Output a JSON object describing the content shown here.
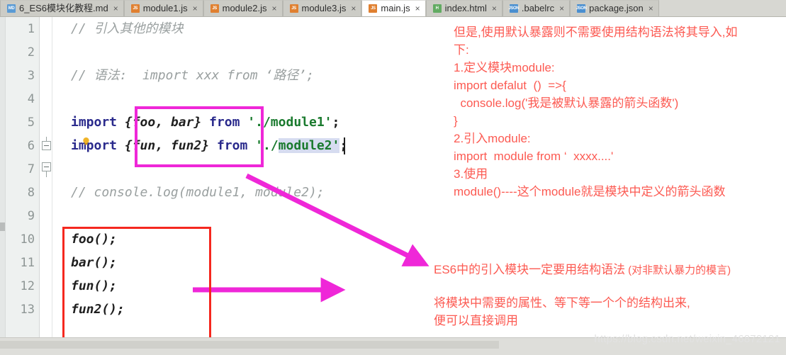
{
  "window": {
    "app": "WebStorm code editor",
    "watermark": "https://blog.csdn.net/weixin_46872121"
  },
  "tabs": [
    {
      "label": "6_ES6模块化教程.md",
      "icon": "markdown-file-icon",
      "icon_text": "MD",
      "icon_class": "icon-md",
      "active": false,
      "close": "×"
    },
    {
      "label": "module1.js",
      "icon": "javascript-file-icon",
      "icon_text": "JS",
      "icon_class": "icon-js",
      "active": false,
      "close": "×"
    },
    {
      "label": "module2.js",
      "icon": "javascript-file-icon",
      "icon_text": "JS",
      "icon_class": "icon-js",
      "active": false,
      "close": "×"
    },
    {
      "label": "module3.js",
      "icon": "javascript-file-icon",
      "icon_text": "JS",
      "icon_class": "icon-js",
      "active": false,
      "close": "×"
    },
    {
      "label": "main.js",
      "icon": "javascript-file-icon",
      "icon_text": "JS",
      "icon_class": "icon-js",
      "active": true,
      "close": "×"
    },
    {
      "label": "index.html",
      "icon": "html-file-icon",
      "icon_text": "H",
      "icon_class": "icon-html",
      "active": false,
      "close": "×"
    },
    {
      "label": ".babelrc",
      "icon": "json-file-icon",
      "icon_text": "JSON",
      "icon_class": "icon-json",
      "active": false,
      "close": "×"
    },
    {
      "label": "package.json",
      "icon": "json-file-icon",
      "icon_text": "JSON",
      "icon_class": "icon-json",
      "active": false,
      "close": "×"
    }
  ],
  "editor": {
    "current_line": 6,
    "line_numbers": [
      "1",
      "2",
      "3",
      "4",
      "5",
      "6",
      "7",
      "8",
      "9",
      "10",
      "11",
      "12",
      "13"
    ],
    "lines": [
      {
        "n": 1,
        "comment": "// 引入其他的模块"
      },
      {
        "n": 2,
        "empty": true
      },
      {
        "n": 3,
        "comment": "// 语法:  import xxx from ‘路径’;"
      },
      {
        "n": 4,
        "empty": true
      },
      {
        "n": 5,
        "kw1": "import",
        "binding": "{foo, bar}",
        "kw2": "from",
        "path": "'./module1'",
        "semi": ";"
      },
      {
        "n": 6,
        "kw1": "import",
        "binding": "{fun, fun2}",
        "kw2": "from",
        "path_pre": "'./",
        "path_sel": "module2'",
        "semi": ";"
      },
      {
        "n": 7,
        "empty": true
      },
      {
        "n": 8,
        "comment": "// console.log(module1, module2);"
      },
      {
        "n": 9,
        "empty": true
      },
      {
        "n": 10,
        "call": "foo();"
      },
      {
        "n": 11,
        "call": "bar();"
      },
      {
        "n": 12,
        "call": "fun();"
      },
      {
        "n": 13,
        "call": "fun2();"
      }
    ]
  },
  "annotations": {
    "top_right": [
      "但是,使用默认暴露则不需要使用结构语法将其导入,如",
      "下:",
      "1.定义模块module:",
      "import defalut  ()  =>{",
      "  console.log('我是被默认暴露的箭头函数')",
      "}",
      "2.引入module:",
      "import  module from ‘  xxxx....'",
      "3.使用",
      "module()----这个module就是模块中定义的箭头函数"
    ],
    "arrow_note_main": "ES6中的引入模块一定要用结构语法",
    "arrow_note_paren": "(对非默认暴力的模言)",
    "bottom_note": [
      "将模块中需要的属性、等下等一个个的结构出来,",
      "便可以直接调用"
    ]
  },
  "colors": {
    "magenta_box": "#ef27d8",
    "red_box": "#f5281f",
    "annotation_text": "#fc5a52",
    "keyword": "#2a2a8c",
    "string": "#1a7a2e",
    "comment": "#9aa0a0",
    "current_line": "#fdf6dd",
    "selection": "#d6dcf0"
  }
}
